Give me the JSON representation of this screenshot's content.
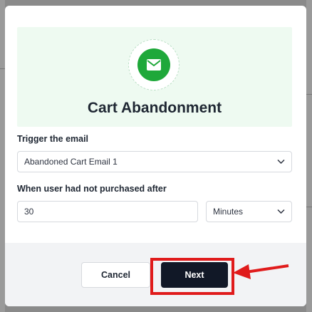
{
  "modal": {
    "title": "Cart Abandonment",
    "trigger_label": "Trigger the email",
    "trigger_value": "Abandoned Cart Email 1",
    "delay_label": "When user had not purchased after",
    "delay_value": "30",
    "delay_unit": "Minutes",
    "cancel_label": "Cancel",
    "next_label": "Next"
  },
  "colors": {
    "accent_green": "#1fa83a",
    "hero_bg": "#eefaf1",
    "primary_button": "#111827",
    "highlight": "#e01b1b"
  },
  "icons": {
    "hero": "email-icon",
    "select_chevron": "chevron-down-icon",
    "annotation": "arrow-left-icon"
  }
}
